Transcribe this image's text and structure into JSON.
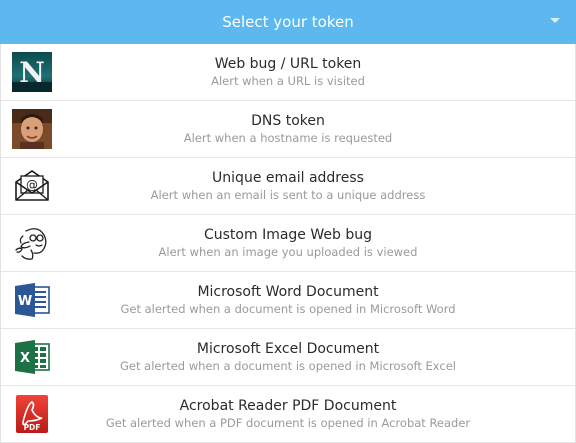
{
  "header": {
    "title": "Select your token"
  },
  "items": [
    {
      "icon": "netscape-n-icon",
      "title": "Web bug / URL token",
      "desc": "Alert when a URL is visited"
    },
    {
      "icon": "person-photo-icon",
      "title": "DNS token",
      "desc": "Alert when a hostname is requested"
    },
    {
      "icon": "email-envelope-icon",
      "title": "Unique email address",
      "desc": "Alert when an email is sent to a unique address"
    },
    {
      "icon": "face-sketch-icon",
      "title": "Custom Image Web bug",
      "desc": "Alert when an image you uploaded is viewed"
    },
    {
      "icon": "microsoft-word-icon",
      "title": "Microsoft Word Document",
      "desc": "Get alerted when a document is opened in Microsoft Word"
    },
    {
      "icon": "microsoft-excel-icon",
      "title": "Microsoft Excel Document",
      "desc": "Get alerted when a document is opened in Microsoft Excel"
    },
    {
      "icon": "acrobat-pdf-icon",
      "title": "Acrobat Reader PDF Document",
      "desc": "Get alerted when a PDF document is opened in Acrobat Reader"
    }
  ],
  "colors": {
    "header_bg": "#5cb8ef",
    "word_blue": "#2b5797",
    "excel_green": "#1e7145",
    "acrobat_red": "#d9261c"
  }
}
